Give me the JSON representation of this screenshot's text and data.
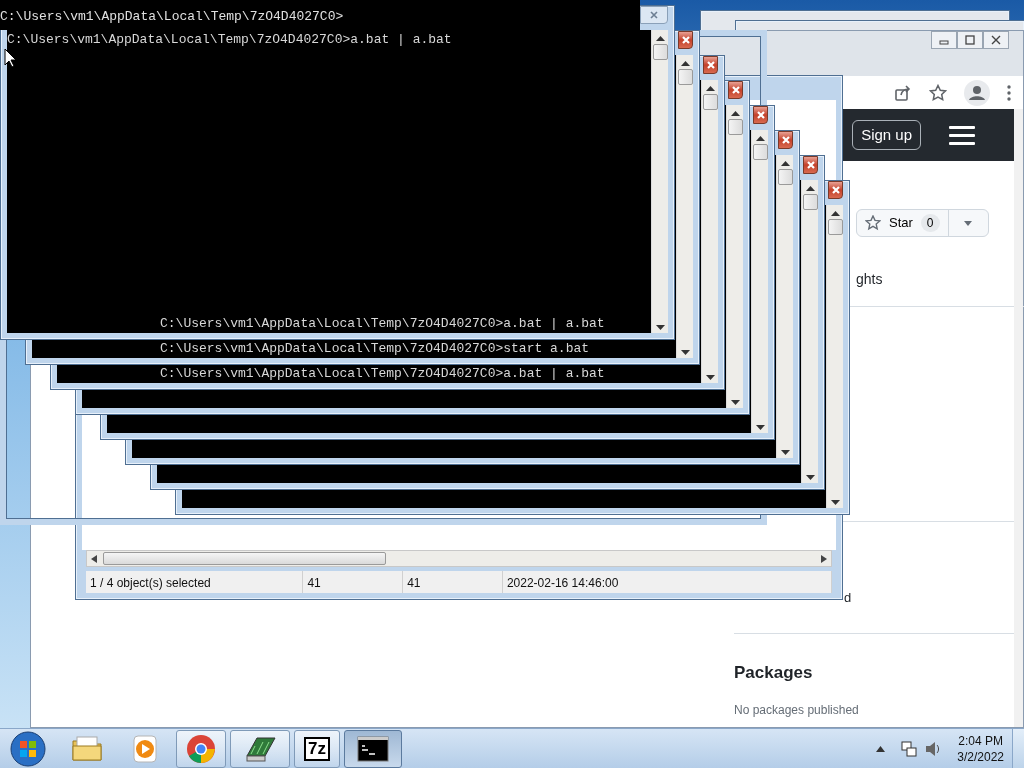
{
  "browser": {
    "sign_up": "Sign up",
    "star_button": {
      "label": "Star",
      "count": "0"
    },
    "about_fragment": "ghts",
    "sidebar_fragment": "d",
    "packages": {
      "title": "Packages",
      "text": "No packages published"
    }
  },
  "archive_manager": {
    "status_bar": [
      "1 / 4 object(s) selected",
      "41",
      "41",
      "2022-02-16 14:46:00"
    ]
  },
  "console_fragment": {
    "line": "C:\\Users\\vm1\\AppData\\Local\\Temp\\7zO4D4027C0>"
  },
  "console_windows": [
    {
      "kind": "console",
      "lines": [
        "C:\\Users\\vm1\\AppData\\Local\\Temp\\7zO4D4027C0>a.bat | a.bat"
      ],
      "tail": [
        "C:\\Users\\vm1\\AppData\\Local\\Temp\\7zO4D4027C0>a.bat | a.bat"
      ]
    },
    {
      "kind": "console",
      "tail": [
        "C:\\Users\\vm1\\AppData\\Local\\Temp\\7zO4D4027C0>start a.bat"
      ]
    },
    {
      "kind": "console",
      "tail": [
        "C:\\Users\\vm1\\AppData\\Local\\Temp\\7zO4D4027C0>a.bat | a.bat"
      ]
    },
    {
      "kind": "console"
    },
    {
      "kind": "console"
    },
    {
      "kind": "console"
    },
    {
      "kind": "console"
    },
    {
      "kind": "console"
    }
  ],
  "taskbar": {
    "apps": [
      {
        "kind": "explorer",
        "running": false,
        "selected": false
      },
      {
        "kind": "media-player",
        "running": false,
        "selected": false
      },
      {
        "kind": "browser",
        "running": true,
        "selected": false
      },
      {
        "kind": "archive-manager",
        "running": true,
        "selected": false
      },
      {
        "kind": "archive",
        "label": "7z",
        "running": true,
        "selected": false
      },
      {
        "kind": "console",
        "running": true,
        "selected": true
      }
    ],
    "clock": {
      "time": "2:04 PM",
      "date": "3/2/2022"
    }
  }
}
